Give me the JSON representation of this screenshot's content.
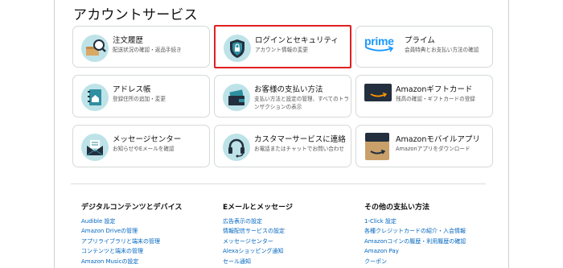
{
  "page": {
    "title": "アカウントサービス"
  },
  "cards": [
    {
      "name": "card-order-history",
      "title": "注文履歴",
      "desc": "配送状況の確認・返品手続き",
      "icon": "package-search-icon"
    },
    {
      "name": "card-login-security",
      "title": "ログインとセキュリティ",
      "desc": "アカウント情報の変更",
      "icon": "shield-lock-icon"
    },
    {
      "name": "card-prime",
      "title": "プライム",
      "desc": "会員特典とお支払い方法の確認",
      "icon": "prime-logo-icon",
      "logo_text": "prime"
    },
    {
      "name": "card-address-book",
      "title": "アドレス帳",
      "desc": "登録住所の追加・変更",
      "icon": "address-book-icon"
    },
    {
      "name": "card-payment",
      "title": "お客様の支払い方法",
      "desc": "支払い方法と設定の管理、すべてのトランザクションの表示",
      "icon": "wallet-card-icon"
    },
    {
      "name": "card-gift-card",
      "title": "Amazonギフトカード",
      "desc": "残高の確認・ギフトカードの登録",
      "icon": "gift-card-icon"
    },
    {
      "name": "card-message-center",
      "title": "メッセージセンター",
      "desc": "お知らせやEメールを確認",
      "icon": "envelope-icon"
    },
    {
      "name": "card-customer-service",
      "title": "カスタマーサービスに連絡",
      "desc": "お電話またはチャットでお問い合わせ",
      "icon": "headset-icon"
    },
    {
      "name": "card-mobile-app",
      "title": "Amazonモバイルアプリ",
      "desc": "Amazonアプリをダウンロード",
      "icon": "amazon-box-icon"
    }
  ],
  "sections": [
    {
      "name": "digital-content",
      "title": "デジタルコンテンツとデバイス",
      "links": [
        "Audible 設定",
        "Amazon Driveの管理",
        "アプリライブラリと端末の管理",
        "コンテンツと端末の管理",
        "Amazon Musicの設定"
      ]
    },
    {
      "name": "email-messages",
      "title": "Eメールとメッセージ",
      "links": [
        "広告表示の設定",
        "情報配信サービスの設定",
        "メッセージセンター",
        "Alexaショッピング通知",
        "セール通知"
      ]
    },
    {
      "name": "other-payment",
      "title": "その他の支払い方法",
      "links": [
        "1-Click 設定",
        "各種クレジットカードの紹介・入会情報",
        "Amazonコインの履歴・利用履歴の確認",
        "Amazon Pay",
        "クーポン"
      ]
    }
  ],
  "colors": {
    "highlight": "#e02020",
    "link": "#0066c0",
    "icon_bg": "#bde3e8",
    "prime_blue": "#1a98ff"
  }
}
